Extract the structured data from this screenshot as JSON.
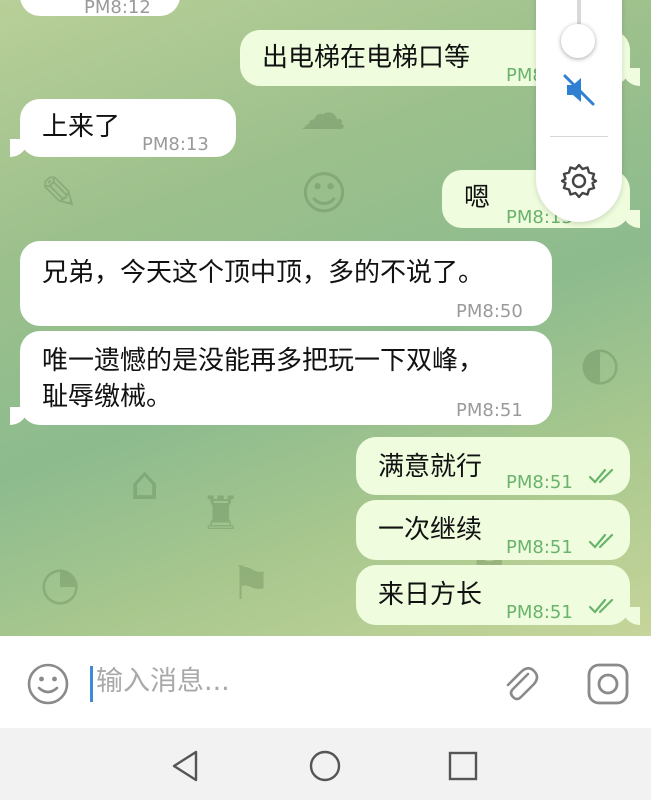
{
  "messages": [
    {
      "id": "m0",
      "side": "in",
      "text": "",
      "time": "PM8:12"
    },
    {
      "id": "m1",
      "side": "out",
      "text": "出电梯在电梯口等",
      "time": "PM8:12"
    },
    {
      "id": "m2",
      "side": "in",
      "text": "上来了",
      "time": "PM8:13"
    },
    {
      "id": "m3",
      "side": "out",
      "text": "嗯",
      "time": "PM8:13"
    },
    {
      "id": "m4",
      "side": "in",
      "text": "兄弟，今天这个顶中顶，多的不说了。",
      "time": "PM8:50"
    },
    {
      "id": "m5",
      "side": "in",
      "line1": "唯一遗憾的是没能再多把玩一下双峰，",
      "line2": "耻辱缴械。",
      "time": "PM8:51"
    },
    {
      "id": "m6",
      "side": "out",
      "text": "满意就行",
      "time": "PM8:51"
    },
    {
      "id": "m7",
      "side": "out",
      "text": "一次继续",
      "time": "PM8:51"
    },
    {
      "id": "m8",
      "side": "out",
      "text": "来日方长",
      "time": "PM8:51"
    }
  ],
  "input": {
    "placeholder": "输入消息..."
  },
  "icons": {
    "emoji": "emoji-icon",
    "attach": "paperclip-icon",
    "camera": "camera-icon",
    "mute": "speaker-muted-icon",
    "settings": "gear-icon",
    "back": "back-triangle-icon",
    "home": "home-circle-icon",
    "recents": "recents-square-icon"
  },
  "colors": {
    "incoming_bubble": "#ffffff",
    "outgoing_bubble": "#effdde",
    "outgoing_time": "#69b36c",
    "accent_blue": "#3d8bd8",
    "caret": "#3d8bd8"
  }
}
